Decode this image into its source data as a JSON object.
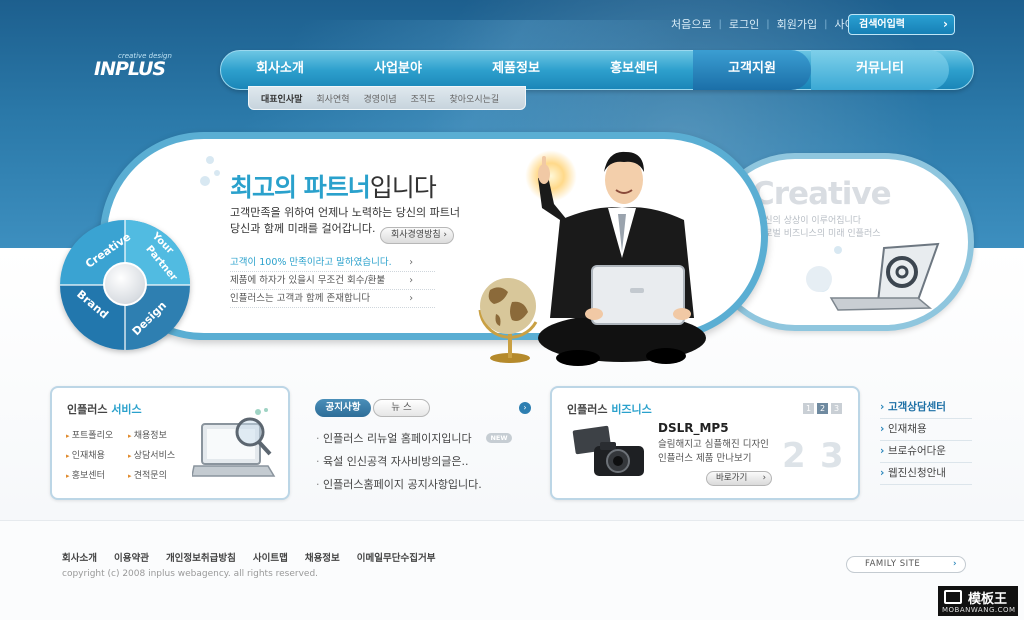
{
  "header": {
    "util_links": [
      "처음으로",
      "로그인",
      "회원가입",
      "사이트맵"
    ],
    "search_label": "검색어입력",
    "logo_small": "creative design",
    "logo_big": "INPLUS"
  },
  "nav": {
    "items": [
      "회사소개",
      "사업분야",
      "제품정보",
      "홍보센터",
      "고객지원",
      "커뮤니티"
    ],
    "sub_items": [
      "대표인사말",
      "회사연혁",
      "경영이념",
      "조직도",
      "찾아오시는길"
    ]
  },
  "hero": {
    "headline_accent": "최고의 파트너",
    "headline_rest": "입니다",
    "sub_line1": "고객만족을 위하여 언제나 노력하는 당신의 파트너",
    "sub_line2": "당신과 함께 미래를 걸어갑니다.",
    "policy_button": "회사경영방침",
    "features": [
      {
        "text": "고객이 100% 만족이라고 말하였습니다."
      },
      {
        "text": "제품에 하자가 있을시 무조건 회수/환불"
      },
      {
        "text": "인플러스는 고객과 함께 존재합니다"
      }
    ],
    "wheel": {
      "seg1": "Creative",
      "seg2": "Your",
      "seg2b": "Partner",
      "seg3": "Design",
      "seg4": "Brand"
    },
    "creative_word": "Creative",
    "creative_line1": "당신의 상상이 이루어집니다",
    "creative_line2": "글로벌 비즈니스의 미래 인플러스"
  },
  "service": {
    "title_plain": "인플러스 ",
    "title_accent": "서비스",
    "links": [
      "포트폴리오",
      "채용정보",
      "인재채용",
      "상담서비스",
      "홍보센터",
      "견적문의"
    ]
  },
  "board": {
    "tab_notice": "공지사항",
    "tab_news": "뉴 스",
    "new_badge": "NEW",
    "items": [
      "인플러스 리뉴얼 홈페이지입니다",
      "육설 인신공격 자사비방의글은..",
      "인플러스홈페이지 공지사항입니다."
    ]
  },
  "business": {
    "title_plain": "인플러스 ",
    "title_accent": "비즈니스",
    "pages": [
      "1",
      "2",
      "3"
    ],
    "product": "DSLR_MP5",
    "desc_line1": "슬림해지고 심플해진 디자인",
    "desc_line2": "인플러스 제품 만나보기",
    "go_button": "바로가기",
    "big_num1": "2",
    "big_num2": "3"
  },
  "side_links": [
    "고객상담센터",
    "인재채용",
    "브로슈어다운",
    "웹진신청안내"
  ],
  "footer": {
    "links": [
      "회사소개",
      "이용약관",
      "개인정보취급방침",
      "사이트맵",
      "채용정보",
      "이메일무단수집거부"
    ],
    "copyright": "copyright (c) 2008 inplus webagency.  all rights reserved.",
    "family_site": "FAMILY SITE",
    "watermark_top": "模板王",
    "watermark_bottom": "MOBANWANG.COM"
  },
  "colors": {
    "brand_blue": "#2a78a8",
    "accent_cyan": "#2aa1cc",
    "accent_orange": "#e08a2c"
  }
}
